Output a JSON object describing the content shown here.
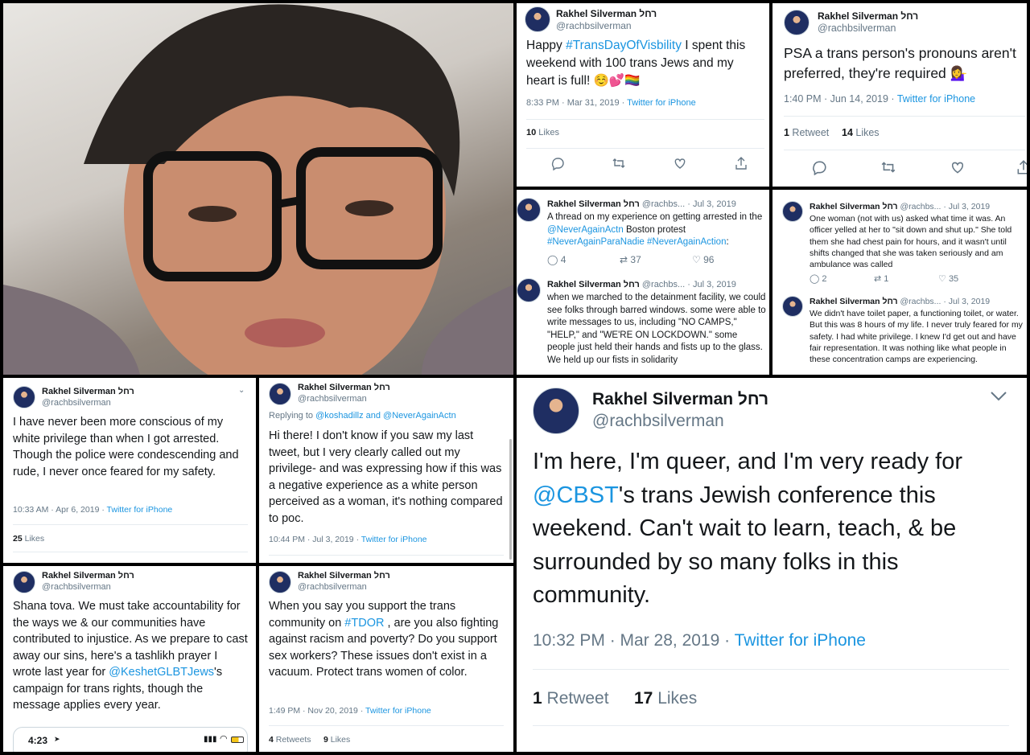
{
  "profile": {
    "name": "Rakhel Silverman רחל",
    "handle": "@rachbsilverman"
  },
  "tweets": {
    "t1": {
      "text_before": "Happy ",
      "hashtag": "#TransDayOfVisbility",
      "text_after": " I spent this weekend with 100 trans Jews and my heart is full! ☺️💕🏳️‍🌈",
      "time": "8:33 PM · Mar 31, 2019 · ",
      "source": "Twitter for iPhone",
      "likes_count": "10",
      "likes_label": " Likes"
    },
    "t2": {
      "text": "PSA a trans person's pronouns aren't preferred, they're required 💁‍♀️",
      "time": "1:40 PM · Jun 14, 2019 · ",
      "source": "Twitter for iPhone",
      "retweets_count": "1",
      "retweets_label": " Retweet",
      "likes_count": "14",
      "likes_label": " Likes"
    },
    "t3": {
      "handle_short": "@rachbs...",
      "date": "· Jul 3, 2019",
      "text1": "A thread on my experience on getting arrested in the ",
      "mention": "@NeverAgainActn",
      "text2": " Boston protest ",
      "tags": "#NeverAgainParaNadie #NeverAgainAction",
      "text3": ":",
      "replies": "4",
      "retweets": "37",
      "likes": "96"
    },
    "t4": {
      "handle_short": "@rachbs...",
      "date": "· Jul 3, 2019",
      "text": "when we marched to the detainment facility, we could see folks through barred windows.  some were able to write messages to us, including \"NO CAMPS,\" \"HELP,\" and \"WE'RE ON LOCKDOWN.\"  some people just held their hands and fists up to the glass.  We held up our fists in solidarity"
    },
    "t5": {
      "handle_short": "@rachbs...",
      "date": "· Jul 3, 2019",
      "text": "One woman (not with us) asked what time it was. An officer yelled at her to \"sit down and shut up.\" She told them she had chest pain for hours, and it wasn't until shifts changed that she was taken seriously and am ambulance was called",
      "replies": "2",
      "retweets": "1",
      "likes": "35"
    },
    "t6": {
      "handle_short": "@rachbs...",
      "date": "· Jul 3, 2019",
      "text": "We didn't have toilet paper, a functioning toilet, or water. But this was 8 hours of my life. I never truly feared for my safety. I had white privilege. I knew I'd get out and have fair representation. It was nothing like what people in these concentration camps are experiencing."
    },
    "t7": {
      "text": "I have never been more conscious of my white privilege than when I got arrested. Though the police were condescending and rude, I never once feared for my safety.",
      "time": "10:33 AM · Apr 6, 2019 · ",
      "source": "Twitter for iPhone",
      "likes_count": "25",
      "likes_label": " Likes"
    },
    "t8": {
      "replying_prefix": "Replying to ",
      "replying_to": "@koshadillz and @NeverAgainActn",
      "text": "Hi there! I don't know if you saw my last tweet, but I very clearly called out my privilege- and was expressing how if this was a negative experience as a white person perceived as a woman, it's nothing compared to poc.",
      "time": "10:44 PM · Jul 3, 2019 · ",
      "source": "Twitter for iPhone"
    },
    "t9": {
      "text1": "Shana tova. We must take accountability for the ways we & our communities have contributed to injustice. As we prepare to cast away our sins, here's a tashlikh prayer I wrote last year for ",
      "mention": "@KeshetGLBTJews",
      "text2": "'s campaign for trans rights, though the message applies every year.",
      "phone_time": "4:23"
    },
    "t10": {
      "text1": "When you say you support the trans community on ",
      "hashtag": "#TDOR",
      "text2": " , are you also fighting against racism and poverty? Do you support sex workers? These issues don't exist in a vacuum. Protect trans women of color.",
      "time": "1:49 PM · Nov 20, 2019 · ",
      "source": "Twitter for iPhone",
      "retweets_count": "4",
      "retweets_label": " Retweets",
      "likes_count": "9",
      "likes_label": " Likes"
    },
    "t11": {
      "text1": "I'm here, I'm queer, and I'm very ready for ",
      "mention": "@CBST",
      "text2": "'s trans Jewish conference this weekend. Can't wait to learn, teach, & be surrounded by so many folks in this community.",
      "time": "10:32 PM · Mar 28, 2019 · ",
      "source": "Twitter for iPhone",
      "retweets_count": "1",
      "retweets_label": " Retweet",
      "likes_count": "17",
      "likes_label": " Likes"
    }
  },
  "colors": {
    "link": "#1b95e0",
    "meta": "#657786",
    "text": "#14171a",
    "background": "#000000"
  },
  "icons": [
    "reply-icon",
    "retweet-icon",
    "like-icon",
    "share-icon",
    "chevron-down-icon",
    "wifi-icon",
    "battery-icon"
  ]
}
